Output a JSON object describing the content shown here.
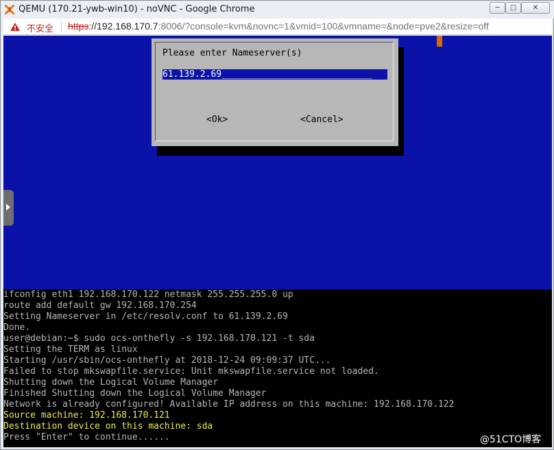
{
  "window": {
    "title": "QEMU (170.21-ywb-win10) - noVNC - Google Chrome",
    "min_glyph": "─",
    "max_glyph": "□",
    "close_glyph": "✕"
  },
  "addressbar": {
    "security_label": "不安全",
    "url_scheme": "https",
    "url_host": "://192.168.170.7",
    "url_rest": ":8006/?console=kvm&novnc=1&vmid=100&vmname=&node=pve2&resize=off"
  },
  "dialog": {
    "prompt": "Please enter Nameserver(s)",
    "field_value": "61.139.2.69____________________________",
    "ok_label": "<Ok>",
    "cancel_label": "<Cancel>"
  },
  "terminal": {
    "lines": [
      "ifconfig eth1 192.168.170.122 netmask 255.255.255.0 up",
      "route add default gw 192.168.170.254",
      "Setting Nameserver in /etc/resolv.conf to 61.139.2.69",
      "Done.",
      "user@debian:~$ sudo ocs-onthefly -s 192.168.170.121 -t sda",
      "Setting the TERM as linux",
      "Starting /usr/sbin/ocs-onthefly at 2018-12-24 09:09:37 UTC...",
      "Failed to stop mkswapfile.service: Unit mkswapfile.service not loaded.",
      "Shutting down the Logical Volume Manager",
      "Finished Shutting down the Logical Volume Manager",
      "Network is already configured! Available IP address on this machine: 192.168.170.122",
      "Source machine: 192.168.170.121",
      "Destination device on this machine: sda",
      "Press \"Enter\" to continue......"
    ]
  },
  "watermark": "@51CTO博客",
  "colors": {
    "vm_background": "#0b12a8",
    "terminal_background": "#000000",
    "terminal_text": "#b6b6b6",
    "highlight_text": "#f2ec4d",
    "dialog_background": "#b7b7b7",
    "insecure_red": "#c5221f"
  }
}
